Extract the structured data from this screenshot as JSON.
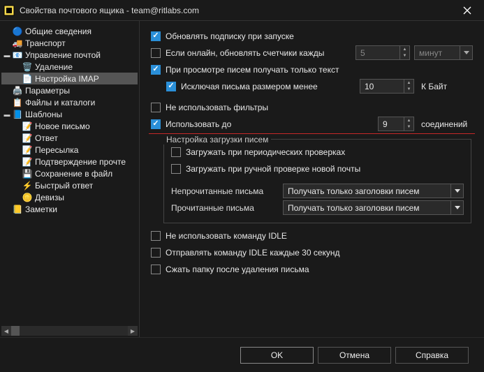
{
  "title": "Свойства почтового ящика - team@ritlabs.com",
  "tree": {
    "general": "Общие сведения",
    "transport": "Транспорт",
    "mail_mgmt": "Управление почтой",
    "delete": "Удаление",
    "imap": "Настройка IMAP",
    "params": "Параметры",
    "files": "Файлы и каталоги",
    "templates": "Шаблоны",
    "new_letter": "Новое письмо",
    "reply": "Ответ",
    "forward": "Пересылка",
    "read_confirm": "Подтверждение прочте",
    "save_file": "Сохранение в файл",
    "quick_reply": "Быстрый ответ",
    "mottos": "Девизы",
    "notes": "Заметки"
  },
  "opts": {
    "refresh_sub": "Обновлять подписку при запуске",
    "if_online": "Если онлайн, обновлять счетчики кажды",
    "interval_val": "5",
    "interval_unit": "минут",
    "view_text_only": "При просмотре писем получать только текст",
    "except_size": "Исключая письма размером менее",
    "size_val": "10",
    "size_unit": "К Байт",
    "no_filters": "Не использовать фильтры",
    "use_up_to": "Использовать до",
    "conn_val": "9",
    "connections": "соединений",
    "download_section": "Настройка загрузки писем",
    "download_periodic": "Загружать при периодических проверках",
    "download_manual": "Загружать при ручной проверке новой почты",
    "unread_label": "Непрочитанные письма",
    "unread_val": "Получать только заголовки писем",
    "read_label": "Прочитанные письма",
    "read_val": "Получать только заголовки писем",
    "no_idle": "Не использовать команду IDLE",
    "idle_30": "Отправлять команду IDLE каждые 30 секунд",
    "compress": "Сжать папку после удаления письма"
  },
  "buttons": {
    "ok": "OK",
    "cancel": "Отмена",
    "help": "Справка"
  }
}
